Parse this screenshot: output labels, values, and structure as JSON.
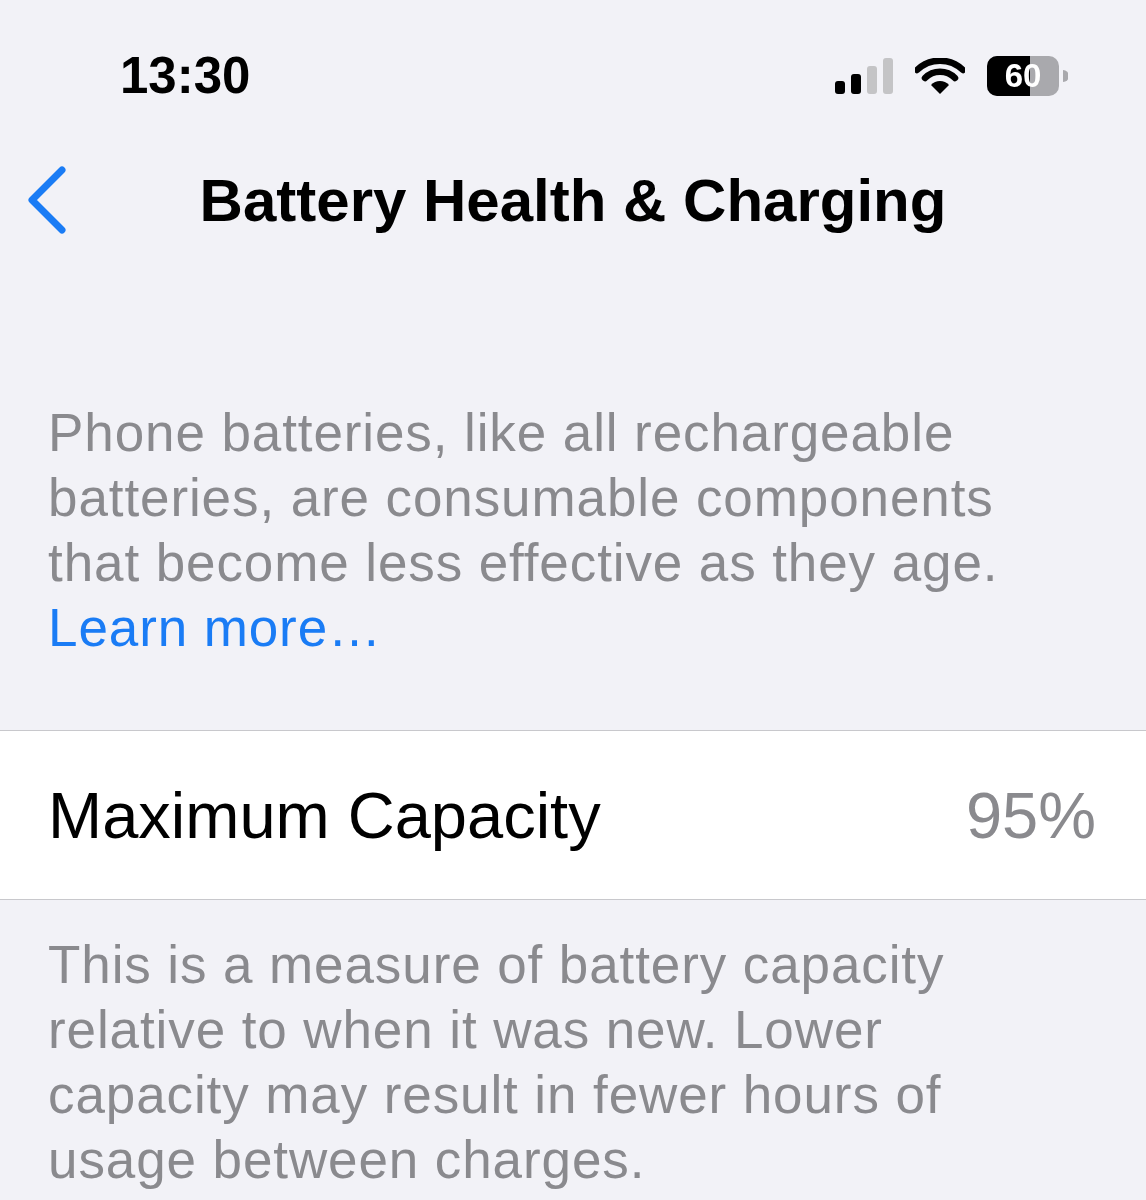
{
  "status_bar": {
    "time": "13:30",
    "battery_text": "60"
  },
  "nav": {
    "title": "Battery Health & Charging"
  },
  "intro": {
    "text": "Phone batteries, like all rechargeable batteries, are consumable components that become less effective as they age.",
    "link": "Learn more…"
  },
  "capacity_row": {
    "label": "Maximum Capacity",
    "value": "95%"
  },
  "capacity_note": "This is a measure of battery capacity relative to when it was new. Lower capacity may result in fewer hours of usage between charges."
}
